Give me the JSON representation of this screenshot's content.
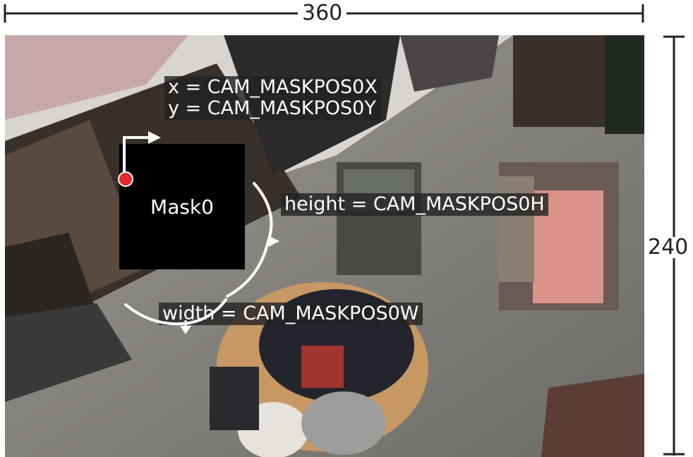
{
  "dimensions": {
    "width_label": "360",
    "height_label": "240"
  },
  "mask": {
    "label": "Mask0"
  },
  "captions": {
    "x": "x = CAM_MASKPOS0X",
    "y": "y = CAM_MASKPOS0Y",
    "height": "height = CAM_MASKPOS0H",
    "width": "width = CAM_MASKPOS0W"
  },
  "colors": {
    "origin_marker": "#e8262b",
    "caption_bg": "#232323",
    "mask_fill": "#000000",
    "arrow": "#ffffff"
  }
}
